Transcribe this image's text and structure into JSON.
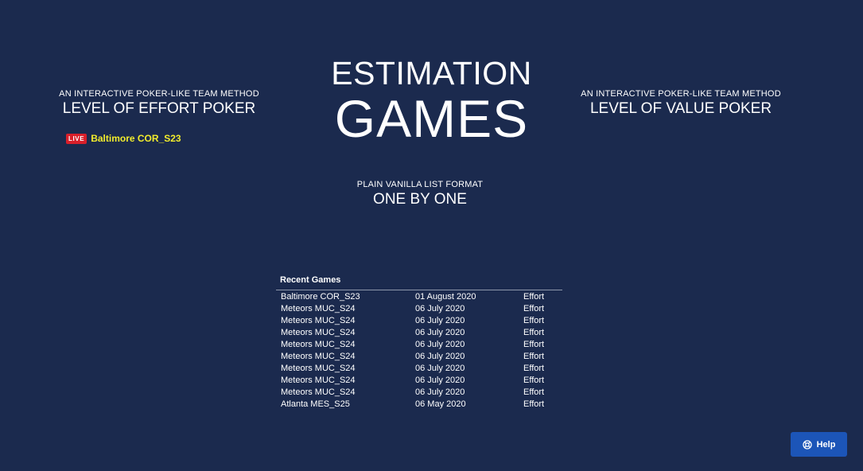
{
  "title": {
    "line1": "ESTIMATION",
    "line2": "GAMES"
  },
  "left_block": {
    "subtitle": "AN INTERACTIVE POKER-LIKE TEAM METHOD",
    "title": "LEVEL OF EFFORT POKER"
  },
  "live": {
    "badge": "LIVE",
    "name": "Baltimore COR_S23"
  },
  "right_block": {
    "subtitle": "AN INTERACTIVE POKER-LIKE TEAM METHOD",
    "title": "LEVEL OF VALUE POKER"
  },
  "center_block": {
    "subtitle": "PLAIN VANILLA LIST FORMAT",
    "title": "ONE BY ONE"
  },
  "recent_games": {
    "heading": "Recent Games",
    "rows": [
      {
        "name": "Baltimore COR_S23",
        "date": "01 August 2020",
        "type": "Effort"
      },
      {
        "name": "Meteors MUC_S24",
        "date": "06 July 2020",
        "type": "Effort"
      },
      {
        "name": "Meteors MUC_S24",
        "date": "06 July 2020",
        "type": "Effort"
      },
      {
        "name": "Meteors MUC_S24",
        "date": "06 July 2020",
        "type": "Effort"
      },
      {
        "name": "Meteors MUC_S24",
        "date": "06 July 2020",
        "type": "Effort"
      },
      {
        "name": "Meteors MUC_S24",
        "date": "06 July 2020",
        "type": "Effort"
      },
      {
        "name": "Meteors MUC_S24",
        "date": "06 July 2020",
        "type": "Effort"
      },
      {
        "name": "Meteors MUC_S24",
        "date": "06 July 2020",
        "type": "Effort"
      },
      {
        "name": "Meteors MUC_S24",
        "date": "06 July 2020",
        "type": "Effort"
      },
      {
        "name": "Atlanta MES_S25",
        "date": "06 May 2020",
        "type": "Effort"
      }
    ]
  },
  "help": {
    "label": "Help",
    "icon": "lifebuoy-icon"
  },
  "colors": {
    "background": "#1b2a4e",
    "live_badge": "#d81f2a",
    "live_name": "#f2ec2c",
    "help_button": "#1c55b8"
  }
}
